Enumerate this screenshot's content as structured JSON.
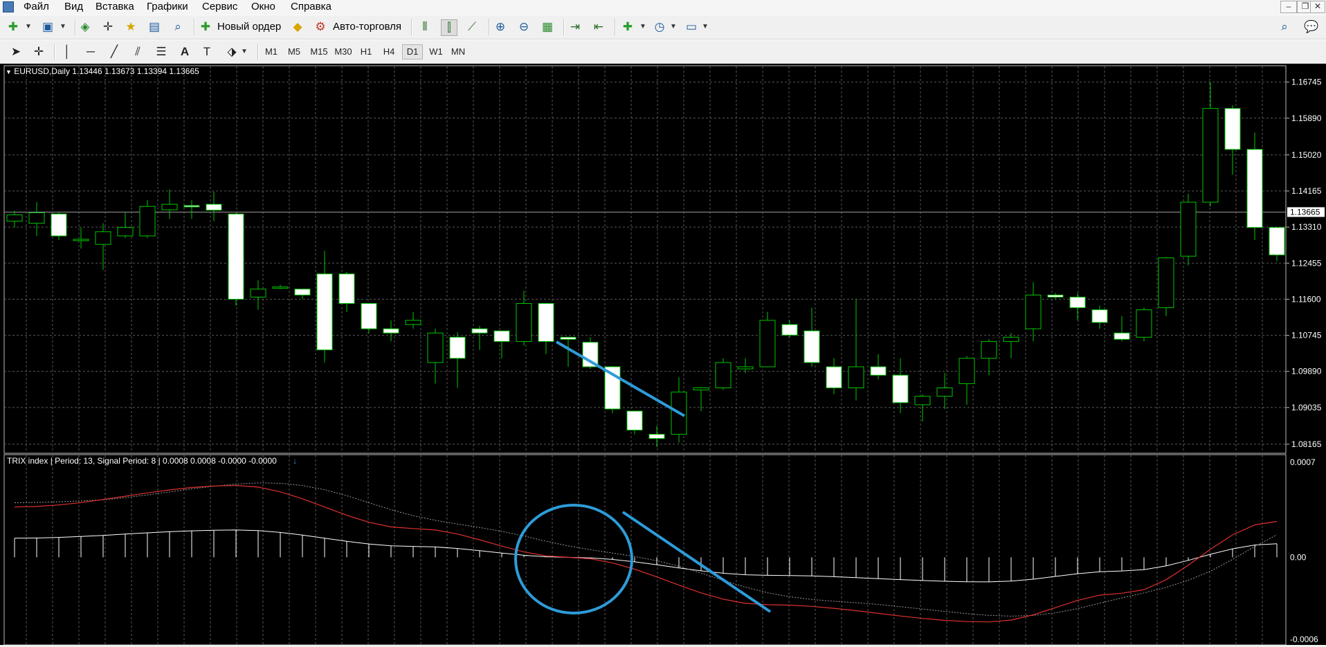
{
  "menu": {
    "items": [
      "Файл",
      "Вид",
      "Вставка",
      "Графики",
      "Сервис",
      "Окно",
      "Справка"
    ]
  },
  "toolbar1": {
    "new_order_label": "Новый ордер",
    "auto_trading_label": "Авто-торговля",
    "icons": [
      "new-chart-icon",
      "profiles-icon",
      "market-watch-icon",
      "navigator-icon",
      "favorites-icon",
      "terminal-icon",
      "tester-icon",
      "new-order-icon",
      "auto-trading-icon",
      "bar-chart-icon",
      "candles-icon",
      "line-chart-icon",
      "zoom-in-icon",
      "zoom-out-icon",
      "tile-icon",
      "autoscroll-icon",
      "chart-shift-icon",
      "indicators-icon",
      "periods-icon",
      "templates-icon",
      "search-icon",
      "chat-icon"
    ]
  },
  "toolbar2": {
    "timeframes": [
      "M1",
      "M5",
      "M15",
      "M30",
      "H1",
      "H4",
      "D1",
      "W1",
      "MN"
    ],
    "active_timeframe": "D1",
    "tool_labels": [
      "A"
    ]
  },
  "chart": {
    "header": "EURUSD,Daily  1.13446 1.13673 1.13394 1.13665",
    "current_price": "1.13665",
    "background": "#000000",
    "bull_color": "#00c800",
    "bear_fill": "#ffffff",
    "price_labels": [
      "1.16745",
      "1.15890",
      "1.15020",
      "1.14165",
      "1.13310",
      "1.12455",
      "1.11600",
      "1.10745",
      "1.09890",
      "1.09035",
      "1.08165"
    ]
  },
  "indicator": {
    "header": "TRIX index | Period: 13, Signal Period: 8 |  0.0008 0.0008 -0.0000 -0.0000",
    "labels": [
      "0.0007",
      "0.00",
      "-0.0006"
    ],
    "trix_color": "#e03030",
    "signal_color": "#9a9a9a",
    "histogram_color": "#ffffff",
    "annotation_color": "#2e9bd8"
  },
  "chart_data": {
    "type": "candlestick",
    "symbol": "EURUSD",
    "timeframe": "Daily",
    "ohlc": [
      [
        1.1345,
        1.137,
        1.133,
        1.136
      ],
      [
        1.134,
        1.139,
        1.131,
        1.1365
      ],
      [
        1.1362,
        1.1365,
        1.13,
        1.131
      ],
      [
        1.13,
        1.133,
        1.128,
        1.1302
      ],
      [
        1.129,
        1.134,
        1.123,
        1.132
      ],
      [
        1.131,
        1.1365,
        1.1305,
        1.133
      ],
      [
        1.131,
        1.1395,
        1.1305,
        1.138
      ],
      [
        1.1372,
        1.142,
        1.135,
        1.1385
      ],
      [
        1.1382,
        1.1395,
        1.135,
        1.138
      ],
      [
        1.1385,
        1.1415,
        1.1345,
        1.1371
      ],
      [
        1.1362,
        1.1364,
        1.1145,
        1.116
      ],
      [
        1.1165,
        1.1205,
        1.1135,
        1.1184
      ],
      [
        1.1189,
        1.1194,
        1.1184,
        1.1189
      ],
      [
        1.1184,
        1.1184,
        1.116,
        1.117
      ],
      [
        1.122,
        1.1275,
        1.101,
        1.104
      ],
      [
        1.122,
        1.1225,
        1.113,
        1.115
      ],
      [
        1.115,
        1.115,
        1.108,
        1.109
      ],
      [
        1.109,
        1.111,
        1.106,
        1.108
      ],
      [
        1.11,
        1.113,
        1.109,
        1.111
      ],
      [
        1.101,
        1.109,
        1.096,
        1.108
      ],
      [
        1.107,
        1.1082,
        1.095,
        1.102
      ],
      [
        1.109,
        1.1097,
        1.104,
        1.108
      ],
      [
        1.1085,
        1.1085,
        1.102,
        1.106
      ],
      [
        1.106,
        1.118,
        1.105,
        1.115
      ],
      [
        1.115,
        1.115,
        1.103,
        1.106
      ],
      [
        1.107,
        1.107,
        1.1,
        1.1065
      ],
      [
        1.1058,
        1.107,
        1.0995,
        1.1
      ],
      [
        1.1,
        1.1002,
        1.089,
        1.09
      ],
      [
        1.0895,
        1.0895,
        1.084,
        1.085
      ],
      [
        1.084,
        1.086,
        1.081,
        1.083
      ],
      [
        1.084,
        1.0975,
        1.082,
        1.094
      ],
      [
        1.0945,
        1.0952,
        1.0895,
        1.095
      ],
      [
        1.095,
        1.102,
        1.0945,
        1.101
      ],
      [
        1.0995,
        1.102,
        1.0985,
        1.1
      ],
      [
        1.1,
        1.113,
        1.1,
        1.111
      ],
      [
        1.11,
        1.111,
        1.107,
        1.1075
      ],
      [
        1.1085,
        1.114,
        1.1,
        1.101
      ],
      [
        1.1,
        1.102,
        1.0935,
        1.095
      ],
      [
        1.095,
        1.116,
        1.092,
        1.1
      ],
      [
        1.1,
        1.103,
        1.097,
        1.098
      ],
      [
        1.098,
        1.102,
        1.089,
        1.0915
      ],
      [
        1.091,
        1.0935,
        1.087,
        1.093
      ],
      [
        1.093,
        1.0985,
        1.09,
        1.095
      ],
      [
        1.096,
        1.1025,
        1.091,
        1.102
      ],
      [
        1.102,
        1.1065,
        1.098,
        1.106
      ],
      [
        1.106,
        1.108,
        1.102,
        1.107
      ],
      [
        1.109,
        1.12,
        1.106,
        1.117
      ],
      [
        1.117,
        1.1175,
        1.116,
        1.1165
      ],
      [
        1.1165,
        1.1175,
        1.111,
        1.114
      ],
      [
        1.1135,
        1.1145,
        1.109,
        1.1105
      ],
      [
        1.108,
        1.112,
        1.106,
        1.1065
      ],
      [
        1.107,
        1.114,
        1.106,
        1.1135
      ],
      [
        1.114,
        1.126,
        1.112,
        1.1258
      ],
      [
        1.1262,
        1.141,
        1.124,
        1.139
      ],
      [
        1.139,
        1.1675,
        1.138,
        1.1612
      ],
      [
        1.1612,
        1.162,
        1.1455,
        1.1515
      ],
      [
        1.1515,
        1.1555,
        1.13,
        1.133
      ],
      [
        1.133,
        1.133,
        1.125,
        1.1265
      ]
    ],
    "trix": {
      "start": 0.00035,
      "peak": 0.0005,
      "cross_zero_index": 25,
      "trough": -0.00045,
      "end": 0.00025
    },
    "ylim_price": [
      1.08,
      1.1705
    ],
    "ylim_trix": [
      -0.0006,
      0.0007
    ]
  }
}
